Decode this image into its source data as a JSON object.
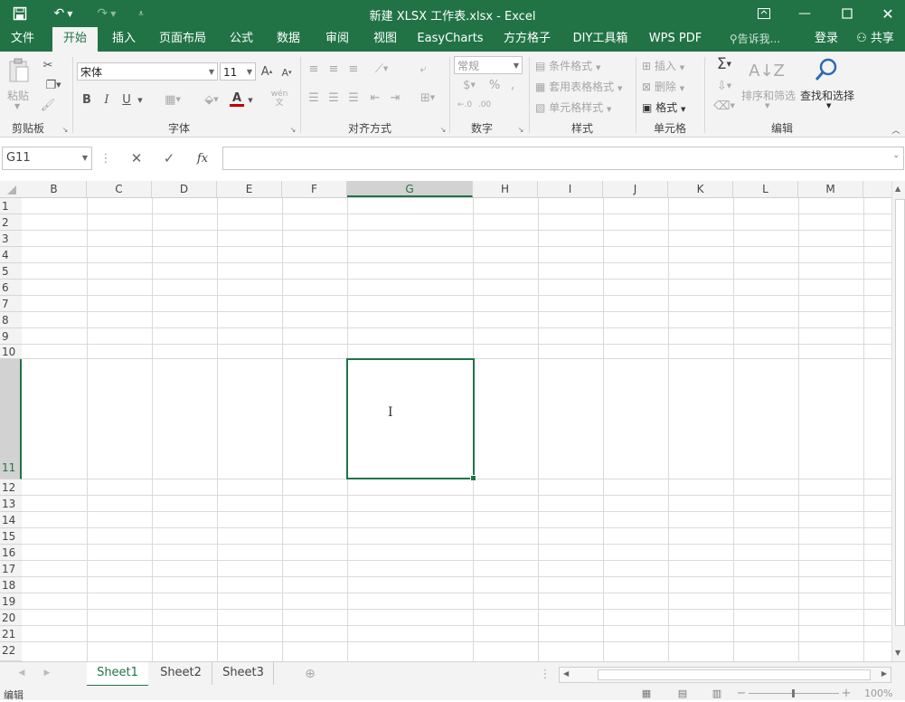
{
  "window": {
    "title": "新建 XLSX 工作表.xlsx - Excel",
    "accent": "#217346"
  },
  "menu": {
    "tabs": [
      "文件",
      "开始",
      "插入",
      "页面布局",
      "公式",
      "数据",
      "审阅",
      "视图",
      "EasyCharts",
      "方方格子",
      "DIY工具箱",
      "WPS PDF"
    ],
    "tell_me": "告诉我...",
    "login": "登录",
    "share": "共享"
  },
  "ribbon": {
    "clipboard": {
      "paste": "粘贴",
      "label": "剪贴板"
    },
    "font": {
      "name": "宋体",
      "size": "11",
      "label": "字体",
      "bold": "B",
      "italic": "I",
      "underline": "U",
      "wen": "wén",
      "wen2": "文"
    },
    "alignment": {
      "label": "对齐方式"
    },
    "number": {
      "format": "常规",
      "percent": "%",
      "comma": ",",
      "label": "数字"
    },
    "styles": {
      "conditional": "条件格式",
      "table": "套用表格格式",
      "cell": "单元格样式",
      "label": "样式"
    },
    "cells": {
      "insert": "插入",
      "delete": "删除",
      "format": "格式",
      "label": "单元格"
    },
    "editing": {
      "sort": "排序和筛选",
      "find": "查找和选择",
      "label": "编辑"
    }
  },
  "formula_bar": {
    "name_box": "G11",
    "fx": "fx",
    "value": ""
  },
  "columns": [
    "B",
    "C",
    "D",
    "E",
    "F",
    "G",
    "H",
    "I",
    "J",
    "K",
    "L",
    "M"
  ],
  "rows": [
    "1",
    "2",
    "3",
    "4",
    "5",
    "6",
    "7",
    "8",
    "9",
    "10",
    "11",
    "12",
    "13",
    "14",
    "15",
    "16",
    "17",
    "18",
    "19",
    "20",
    "21",
    "22"
  ],
  "selected_cell": {
    "column": "G",
    "row": "11"
  },
  "sheets": [
    "Sheet1",
    "Sheet2",
    "Sheet3"
  ],
  "active_sheet": "Sheet1",
  "status": {
    "mode": "编辑",
    "zoom": "100%"
  }
}
